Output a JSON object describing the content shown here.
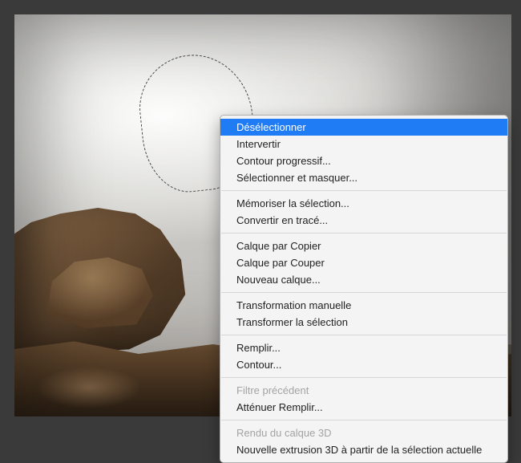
{
  "context_menu": {
    "groups": [
      [
        {
          "id": "deselect",
          "label": "Désélectionner",
          "highlighted": true,
          "enabled": true
        },
        {
          "id": "inverse",
          "label": "Intervertir",
          "enabled": true
        },
        {
          "id": "feather",
          "label": "Contour progressif...",
          "enabled": true
        },
        {
          "id": "select-and-mask",
          "label": "Sélectionner et masquer...",
          "enabled": true
        }
      ],
      [
        {
          "id": "save-selection",
          "label": "Mémoriser la sélection...",
          "enabled": true
        },
        {
          "id": "make-work-path",
          "label": "Convertir en tracé...",
          "enabled": true
        }
      ],
      [
        {
          "id": "layer-via-copy",
          "label": "Calque par Copier",
          "enabled": true
        },
        {
          "id": "layer-via-cut",
          "label": "Calque par Couper",
          "enabled": true
        },
        {
          "id": "new-layer",
          "label": "Nouveau calque...",
          "enabled": true
        }
      ],
      [
        {
          "id": "free-transform",
          "label": "Transformation manuelle",
          "enabled": true
        },
        {
          "id": "transform-selection",
          "label": "Transformer la sélection",
          "enabled": true
        }
      ],
      [
        {
          "id": "fill",
          "label": "Remplir...",
          "enabled": true
        },
        {
          "id": "stroke",
          "label": "Contour...",
          "enabled": true
        }
      ],
      [
        {
          "id": "last-filter",
          "label": "Filtre précédent",
          "enabled": false
        },
        {
          "id": "fade-fill",
          "label": "Atténuer Remplir...",
          "enabled": true
        }
      ],
      [
        {
          "id": "render-3d-layer",
          "label": "Rendu du calque 3D",
          "enabled": false
        },
        {
          "id": "new-3d-extrusion",
          "label": "Nouvelle extrusion 3D à partir de la sélection actuelle",
          "enabled": true
        }
      ]
    ]
  }
}
